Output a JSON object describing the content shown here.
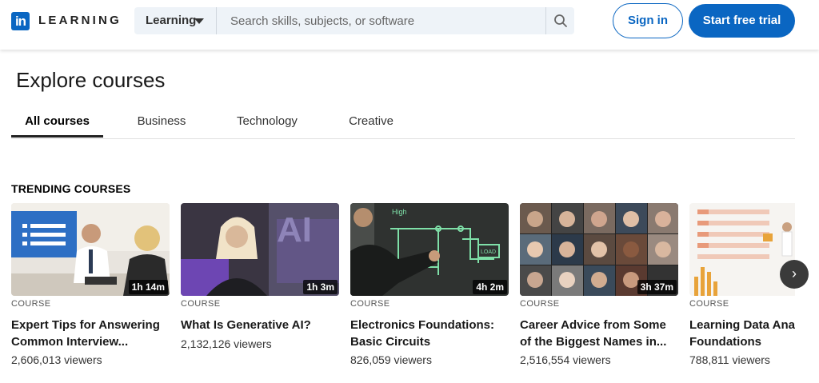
{
  "header": {
    "logo_mark": "in",
    "logo_text": "LEARNING",
    "search_category": "Learning",
    "search_placeholder": "Search skills, subjects, or software",
    "signin_label": "Sign in",
    "trial_label": "Start free trial"
  },
  "page": {
    "title": "Explore courses",
    "tabs": [
      {
        "label": "All courses",
        "active": true
      },
      {
        "label": "Business",
        "active": false
      },
      {
        "label": "Technology",
        "active": false
      },
      {
        "label": "Creative",
        "active": false
      }
    ],
    "section_title": "TRENDING COURSES"
  },
  "courses": [
    {
      "type": "COURSE",
      "duration": "1h 14m",
      "title": "Expert Tips for Answering\nCommon Interview...",
      "viewers": "2,606,013 viewers"
    },
    {
      "type": "COURSE",
      "duration": "1h 3m",
      "title": "What Is Generative AI?",
      "viewers": "2,132,126 viewers"
    },
    {
      "type": "COURSE",
      "duration": "4h 2m",
      "title": "Electronics Foundations:\nBasic Circuits",
      "viewers": "826,059 viewers"
    },
    {
      "type": "COURSE",
      "duration": "3h 37m",
      "title": "Career Advice from Some\nof the Biggest Names in...",
      "viewers": "2,516,554 viewers"
    },
    {
      "type": "COURSE",
      "duration": "",
      "title": "Learning Data Ana\nFoundations",
      "viewers": "788,811 viewers"
    }
  ],
  "thumb_texts": {
    "ai_text": "AI",
    "load_text": "LOAD",
    "high_text": "High"
  },
  "colors": {
    "brand": "#0a66c2",
    "text_primary": "#000000e6"
  }
}
